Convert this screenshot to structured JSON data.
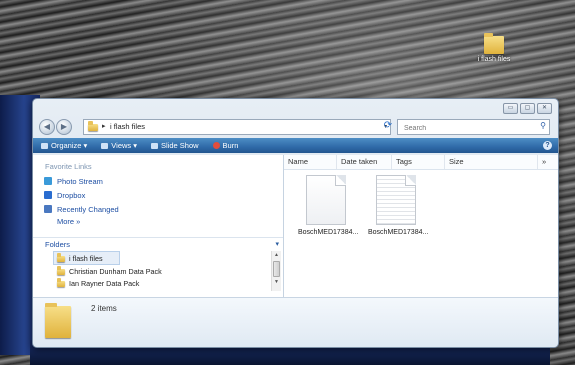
{
  "desktop": {
    "icon_label": "i flash files"
  },
  "window": {
    "controls": [
      "▭",
      "▢",
      "✕"
    ],
    "address": {
      "path": "i flash files",
      "dropdown_glyph": "▾"
    },
    "search": {
      "placeholder": "Search"
    },
    "toolbar": {
      "organize": "Organize ▾",
      "views": "Views ▾",
      "slideshow": "Slide Show",
      "burn": "Burn",
      "help": "?"
    },
    "nav": {
      "favorites_heading": "Favorite Links",
      "favorites": [
        {
          "label": "Photo Stream",
          "color": "#3a9ad9"
        },
        {
          "label": "Dropbox",
          "color": "#2a6dd0"
        },
        {
          "label": "Recently Changed",
          "color": "#4a78c0"
        }
      ],
      "more": "More »",
      "folders_heading": "Folders",
      "folders": [
        "i flash files",
        "Christian Dunham Data Pack",
        "Ian Rayner Data Pack"
      ]
    },
    "columns": [
      "Name",
      "Date taken",
      "Tags",
      "Size",
      "»"
    ],
    "files": [
      {
        "name": "BoschMED17384...",
        "style": "blank"
      },
      {
        "name": "BoschMED17384...",
        "style": "lines"
      }
    ],
    "details": {
      "item_count": "2 items"
    }
  }
}
